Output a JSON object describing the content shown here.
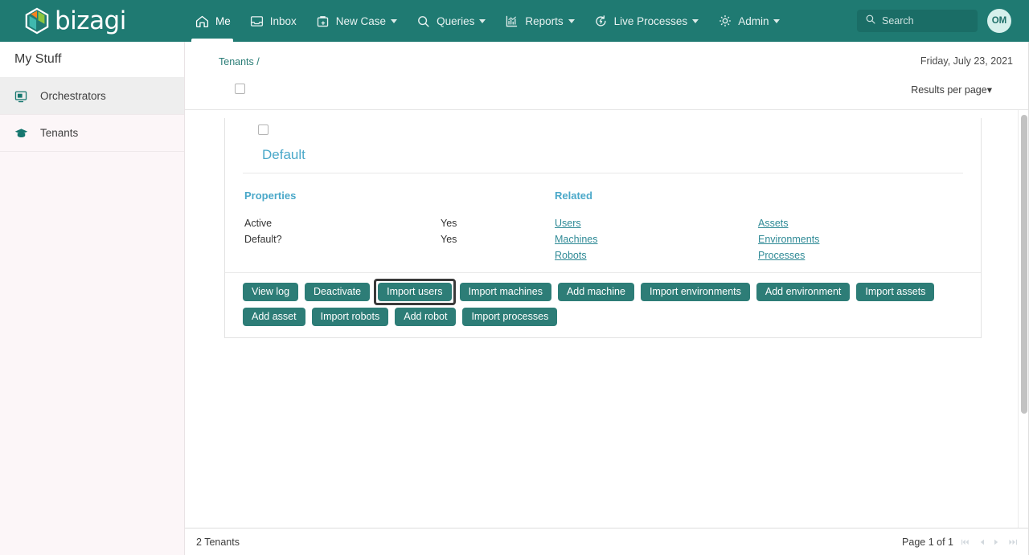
{
  "brand": {
    "name": "bizagi",
    "logo_icon": "bizagi-cube-logo",
    "topbar_color": "#1f7a72",
    "button_color": "#2d7d77",
    "link_color": "#2f8a96",
    "title_color": "#4aa8c9"
  },
  "topnav": {
    "items": [
      {
        "label": "Me",
        "icon": "home-icon",
        "active": true,
        "caret": false
      },
      {
        "label": "Inbox",
        "icon": "inbox-tray-icon",
        "active": false,
        "caret": false
      },
      {
        "label": "New Case",
        "icon": "briefcase-plus-icon",
        "active": false,
        "caret": true
      },
      {
        "label": "Queries",
        "icon": "search-magnifier-icon",
        "active": false,
        "caret": true
      },
      {
        "label": "Reports",
        "icon": "bar-chart-icon",
        "active": false,
        "caret": true
      },
      {
        "label": "Live Processes",
        "icon": "live-process-refresh-icon",
        "active": false,
        "caret": true
      },
      {
        "label": "Admin",
        "icon": "gear-icon",
        "active": false,
        "caret": true
      }
    ],
    "search": {
      "placeholder": "Search",
      "icon": "search-icon",
      "value": ""
    },
    "avatar": {
      "initials": "OM"
    }
  },
  "sidebar": {
    "title": "My Stuff",
    "items": [
      {
        "label": "Orchestrators",
        "icon": "monitor-screen-icon",
        "selected": true
      },
      {
        "label": "Tenants",
        "icon": "graduation-cap-icon",
        "selected": false
      }
    ]
  },
  "content_header": {
    "breadcrumb": "Tenants /",
    "date": "Friday, July 23, 2021",
    "results_per_page": "Results per page",
    "results_per_page_caret": "▾",
    "select_all_checked": false
  },
  "card": {
    "checkbox_checked": false,
    "title": "Default",
    "properties": {
      "heading": "Properties",
      "rows": [
        {
          "key": "Active",
          "value": "Yes"
        },
        {
          "key": "Default?",
          "value": "Yes"
        }
      ]
    },
    "related": {
      "heading": "Related",
      "column_one": [
        "Users",
        "Machines",
        "Robots"
      ],
      "column_two": [
        "Assets",
        "Environments",
        "Processes"
      ]
    },
    "actions": [
      {
        "label": "View log",
        "focused": false
      },
      {
        "label": "Deactivate",
        "focused": false
      },
      {
        "label": "Import users",
        "focused": true
      },
      {
        "label": "Import machines",
        "focused": false
      },
      {
        "label": "Add machine",
        "focused": false
      },
      {
        "label": "Import environments",
        "focused": false
      },
      {
        "label": "Add environment",
        "focused": false
      },
      {
        "label": "Import assets",
        "focused": false
      },
      {
        "label": "Add asset",
        "focused": false
      },
      {
        "label": "Import robots",
        "focused": false
      },
      {
        "label": "Add robot",
        "focused": false
      },
      {
        "label": "Import processes",
        "focused": false
      }
    ]
  },
  "footer": {
    "count_label": "2 Tenants",
    "page_label": "Page 1 of 1",
    "pager": [
      {
        "name": "first-page-button",
        "glyph": "◀◀|"
      },
      {
        "name": "previous-page-button",
        "glyph": "◀"
      },
      {
        "name": "next-page-button",
        "glyph": "▶"
      },
      {
        "name": "last-page-button",
        "glyph": "|▶▶"
      }
    ]
  }
}
